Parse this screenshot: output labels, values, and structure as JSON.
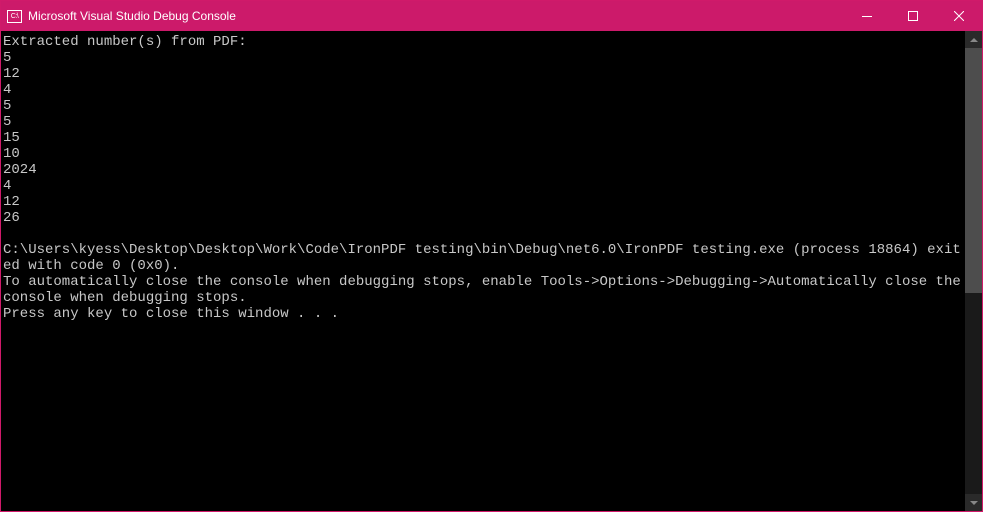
{
  "titlebar": {
    "icon_text": "C:\\",
    "title": "Microsoft Visual Studio Debug Console"
  },
  "console": {
    "header": "Extracted number(s) from PDF:",
    "numbers": [
      "5",
      "12",
      "4",
      "5",
      "5",
      "15",
      "10",
      "2024",
      "4",
      "12",
      "26"
    ],
    "blank": "",
    "exit_line": "C:\\Users\\kyess\\Desktop\\Desktop\\Work\\Code\\IronPDF testing\\bin\\Debug\\net6.0\\IronPDF testing.exe (process 18864) exited with code 0 (0x0).",
    "auto_close_line": "To automatically close the console when debugging stops, enable Tools->Options->Debugging->Automatically close the console when debugging stops.",
    "press_key_line": "Press any key to close this window . . ."
  }
}
